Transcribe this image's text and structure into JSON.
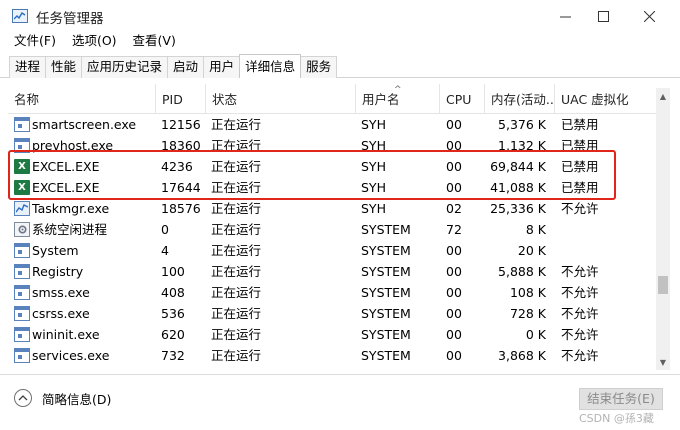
{
  "window": {
    "title": "任务管理器"
  },
  "menu": [
    "文件(F)",
    "选项(O)",
    "查看(V)"
  ],
  "tabs": [
    "进程",
    "性能",
    "应用历史记录",
    "启动",
    "用户",
    "详细信息",
    "服务"
  ],
  "active_tab": "详细信息",
  "columns": [
    "名称",
    "PID",
    "状态",
    "用户名",
    "CPU",
    "内存(活动...",
    "UAC 虚拟化"
  ],
  "rows": [
    {
      "name": "smartscreen.exe",
      "pid": "12156",
      "status": "正在运行",
      "user": "SYH",
      "cpu": "00",
      "mem": "5,376 K",
      "uac": "已禁用",
      "icon": "window-icon"
    },
    {
      "name": "prevhost.exe",
      "pid": "18360",
      "status": "正在运行",
      "user": "SYH",
      "cpu": "00",
      "mem": "1,132 K",
      "uac": "已禁用",
      "icon": "window-icon"
    },
    {
      "name": "EXCEL.EXE",
      "pid": "4236",
      "status": "正在运行",
      "user": "SYH",
      "cpu": "00",
      "mem": "69,844 K",
      "uac": "已禁用",
      "icon": "excel-icon"
    },
    {
      "name": "EXCEL.EXE",
      "pid": "17644",
      "status": "正在运行",
      "user": "SYH",
      "cpu": "00",
      "mem": "41,088 K",
      "uac": "已禁用",
      "icon": "excel-icon"
    },
    {
      "name": "Taskmgr.exe",
      "pid": "18576",
      "status": "正在运行",
      "user": "SYH",
      "cpu": "02",
      "mem": "25,336 K",
      "uac": "不允许",
      "icon": "taskmgr-icon"
    },
    {
      "name": "系统空闲进程",
      "pid": "0",
      "status": "正在运行",
      "user": "SYSTEM",
      "cpu": "72",
      "mem": "8 K",
      "uac": "",
      "icon": "gear-icon"
    },
    {
      "name": "System",
      "pid": "4",
      "status": "正在运行",
      "user": "SYSTEM",
      "cpu": "00",
      "mem": "20 K",
      "uac": "",
      "icon": "window-icon"
    },
    {
      "name": "Registry",
      "pid": "100",
      "status": "正在运行",
      "user": "SYSTEM",
      "cpu": "00",
      "mem": "5,888 K",
      "uac": "不允许",
      "icon": "window-icon"
    },
    {
      "name": "smss.exe",
      "pid": "408",
      "status": "正在运行",
      "user": "SYSTEM",
      "cpu": "00",
      "mem": "108 K",
      "uac": "不允许",
      "icon": "window-icon"
    },
    {
      "name": "csrss.exe",
      "pid": "536",
      "status": "正在运行",
      "user": "SYSTEM",
      "cpu": "00",
      "mem": "728 K",
      "uac": "不允许",
      "icon": "window-icon"
    },
    {
      "name": "wininit.exe",
      "pid": "620",
      "status": "正在运行",
      "user": "SYSTEM",
      "cpu": "00",
      "mem": "0 K",
      "uac": "不允许",
      "icon": "window-icon"
    },
    {
      "name": "services.exe",
      "pid": "732",
      "status": "正在运行",
      "user": "SYSTEM",
      "cpu": "00",
      "mem": "3,868 K",
      "uac": "不允许",
      "icon": "window-icon"
    }
  ],
  "footer": {
    "fewer_details": "简略信息(D)",
    "end_task": "结束任务(E)",
    "watermark": "CSDN @孫3藏"
  },
  "colors": {
    "highlight": "#e0251b",
    "excel": "#1d7a43"
  }
}
